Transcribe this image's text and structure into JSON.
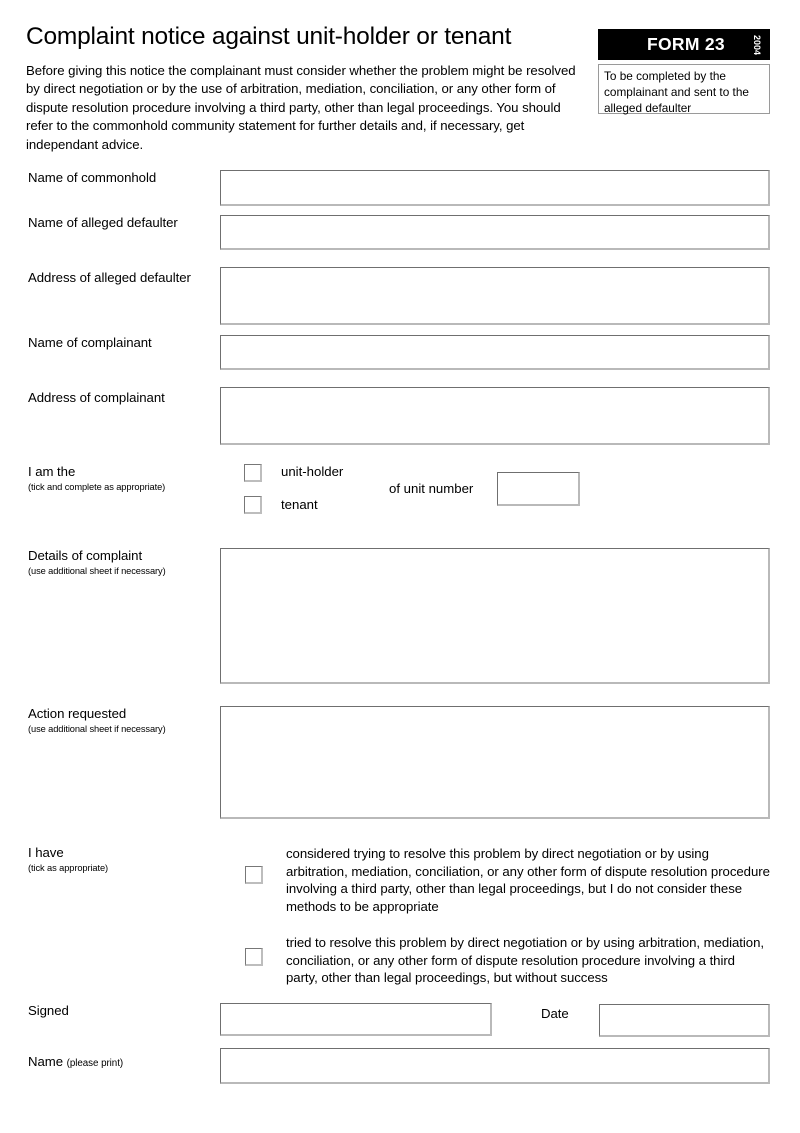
{
  "document": {
    "title": "Complaint notice against unit-holder or tenant",
    "intro": "Before giving this notice the complainant must consider whether the problem might be resolved by direct negotiation or by the use of arbitration, mediation, conciliation, or any other form of dispute resolution procedure involving a third party, other than legal proceedings. You should refer to the commonhold community statement for further details and, if necessary, get independant advice."
  },
  "badge": {
    "form_label": "FORM 23",
    "year": "2004",
    "note": "To be completed by the complainant and sent to the alleged defaulter",
    "background_color": "#000000",
    "text_color": "#ffffff"
  },
  "fields": {
    "commonhold_name": {
      "label": "Name of commonhold",
      "value": ""
    },
    "defaulter_name": {
      "label": "Name of alleged defaulter",
      "value": ""
    },
    "defaulter_address": {
      "label": "Address of alleged defaulter",
      "value": ""
    },
    "complainant_name": {
      "label": "Name of complainant",
      "value": ""
    },
    "complainant_address": {
      "label": "Address of complainant",
      "value": ""
    },
    "unit_number": {
      "label": "of unit number",
      "value": ""
    },
    "details_of_complaint": {
      "label": "Details of complaint",
      "sublabel": "(use additional sheet if necessary)",
      "value": ""
    },
    "action_requested": {
      "label": "Action requested",
      "sublabel": "(use additional sheet if necessary)",
      "value": ""
    },
    "signed": {
      "label": "Signed",
      "value": ""
    },
    "date": {
      "label": "Date",
      "value": ""
    },
    "name_print": {
      "label": "Name",
      "sublabel": "(please print)",
      "value": ""
    }
  },
  "i_am_the": {
    "label": "I am the",
    "sublabel": "(tick and complete as appropriate)",
    "options": [
      {
        "label": "unit-holder",
        "checked": false
      },
      {
        "label": "tenant",
        "checked": false
      }
    ]
  },
  "i_have": {
    "label": "I have",
    "sublabel": "(tick as appropriate)",
    "options": [
      {
        "label": "considered trying to resolve this problem by direct negotiation or by using arbitration, mediation, conciliation, or any other form of dispute resolution procedure involving a third party, other than legal proceedings, but I do not consider these methods to be appropriate",
        "checked": false
      },
      {
        "label": "tried to resolve this problem by direct negotiation or by using arbitration, mediation, conciliation, or any other form of dispute resolution procedure involving a third party, other than legal proceedings, but without success",
        "checked": false
      }
    ]
  }
}
